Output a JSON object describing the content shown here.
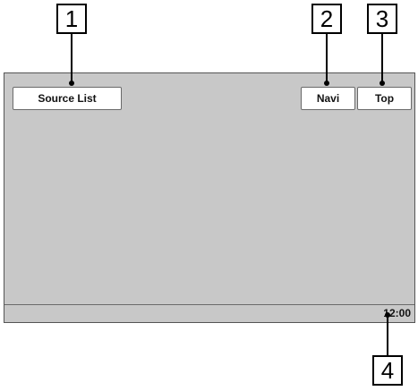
{
  "callouts": [
    "1",
    "2",
    "3",
    "4"
  ],
  "screen": {
    "buttons": {
      "source_list": "Source List",
      "navi": "Navi",
      "top": "Top"
    },
    "status_bar": {
      "clock": "12:00"
    },
    "colors": {
      "screen_background": "#c8c8c8",
      "button_background": "#ffffff"
    }
  }
}
